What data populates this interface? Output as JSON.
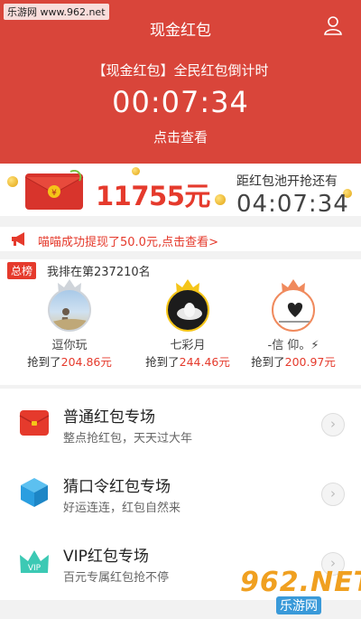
{
  "watermark_top": "乐游网 www.962.net",
  "header": {
    "title": "现金红包",
    "countdown_title": "【现金红包】全民红包倒计时",
    "timer": "00:07:34",
    "check_link": "点击查看"
  },
  "pool": {
    "amount": "11755元",
    "label": "距红包池开抢还有",
    "timer": "04:07:34"
  },
  "notice": {
    "text": "喵喵成功提现了50.0元,点击查看>"
  },
  "rank": {
    "tag": "总榜",
    "me": "我排在第237210名",
    "prefix": "抢到了",
    "winners": [
      {
        "name": "逗你玩",
        "amount": "204.86元",
        "crown": "silver"
      },
      {
        "name": "七彩月",
        "amount": "244.46元",
        "crown": "gold"
      },
      {
        "name": "-信   仰。⚡",
        "amount": "200.97元",
        "crown": "bronze"
      }
    ]
  },
  "menu": [
    {
      "title": "普通红包专场",
      "subtitle": "整点抢红包，天天过大年",
      "icon": "red-envelope-icon"
    },
    {
      "title": "猜口令红包专场",
      "subtitle": "好运连连，红包自然来",
      "icon": "blue-cube-icon"
    },
    {
      "title": "VIP红包专场",
      "subtitle": "百元专属红包抢不停",
      "icon": "vip-crown-icon"
    }
  ],
  "watermark_bottom": {
    "num": "962.NET",
    "site": "乐游网"
  },
  "colors": {
    "header_red": "#d9453a",
    "accent_red": "#e53a2c",
    "gold": "#f5c518",
    "blue": "#29a3e6",
    "teal": "#3cc9b4"
  }
}
